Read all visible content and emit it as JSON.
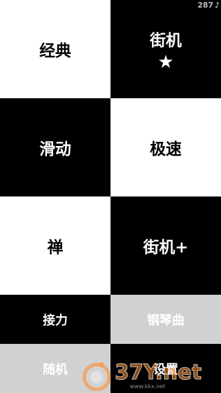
{
  "status": {
    "score": "287",
    "score_icon": "music-note-icon"
  },
  "menu": {
    "classic": "经典",
    "arcade": "街机",
    "arcade_star_icon": "star-icon",
    "slide": "滑动",
    "speed": "极速",
    "zen": "禅",
    "arcade_plus": "街机+",
    "relay": "接力",
    "piano": "钢琴曲",
    "random": "随机",
    "settings": "设置"
  },
  "colors": {
    "white_tile": "#ffffff",
    "black_tile": "#000000",
    "gray_tile": "#d1d1d1"
  },
  "watermark": {
    "brand": "37Y.net",
    "url": "www.kkx.net"
  }
}
